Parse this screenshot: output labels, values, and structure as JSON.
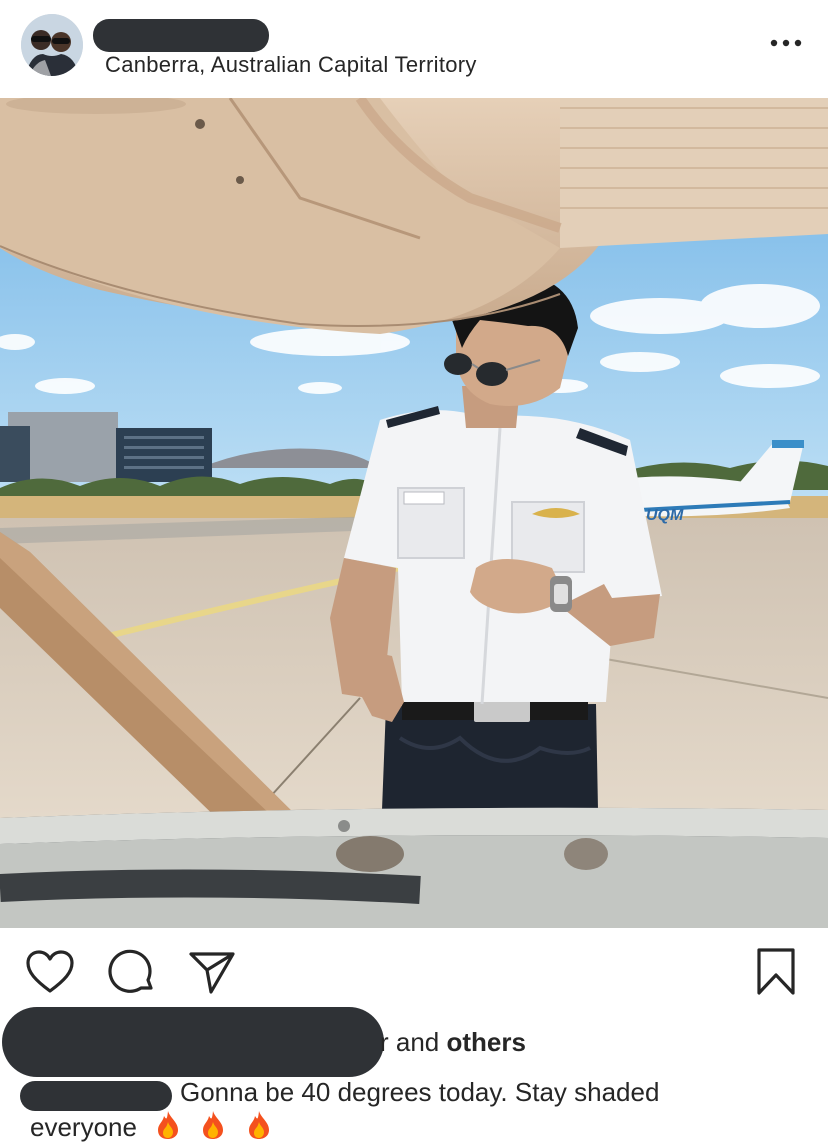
{
  "post": {
    "location": "Canberra, Australian Capital Territory"
  },
  "icons": {
    "more": "more-options-icon",
    "like": "heart-icon",
    "comment": "comment-icon",
    "share": "send-icon",
    "save": "bookmark-icon",
    "fire": "fire-emoji"
  },
  "likes": {
    "fragment": "r and ",
    "others": "others"
  },
  "caption": {
    "line1": "Gonna be 40 degrees today.  Stay shaded",
    "line2": "everyone"
  },
  "photo": {
    "plane_registration": "UQM"
  },
  "colors": {
    "redaction": "#2f3236",
    "text": "#262626",
    "sky": "#8fc4ea",
    "tarmac": "#d8cbbb",
    "wing": "#dfc5aa"
  }
}
